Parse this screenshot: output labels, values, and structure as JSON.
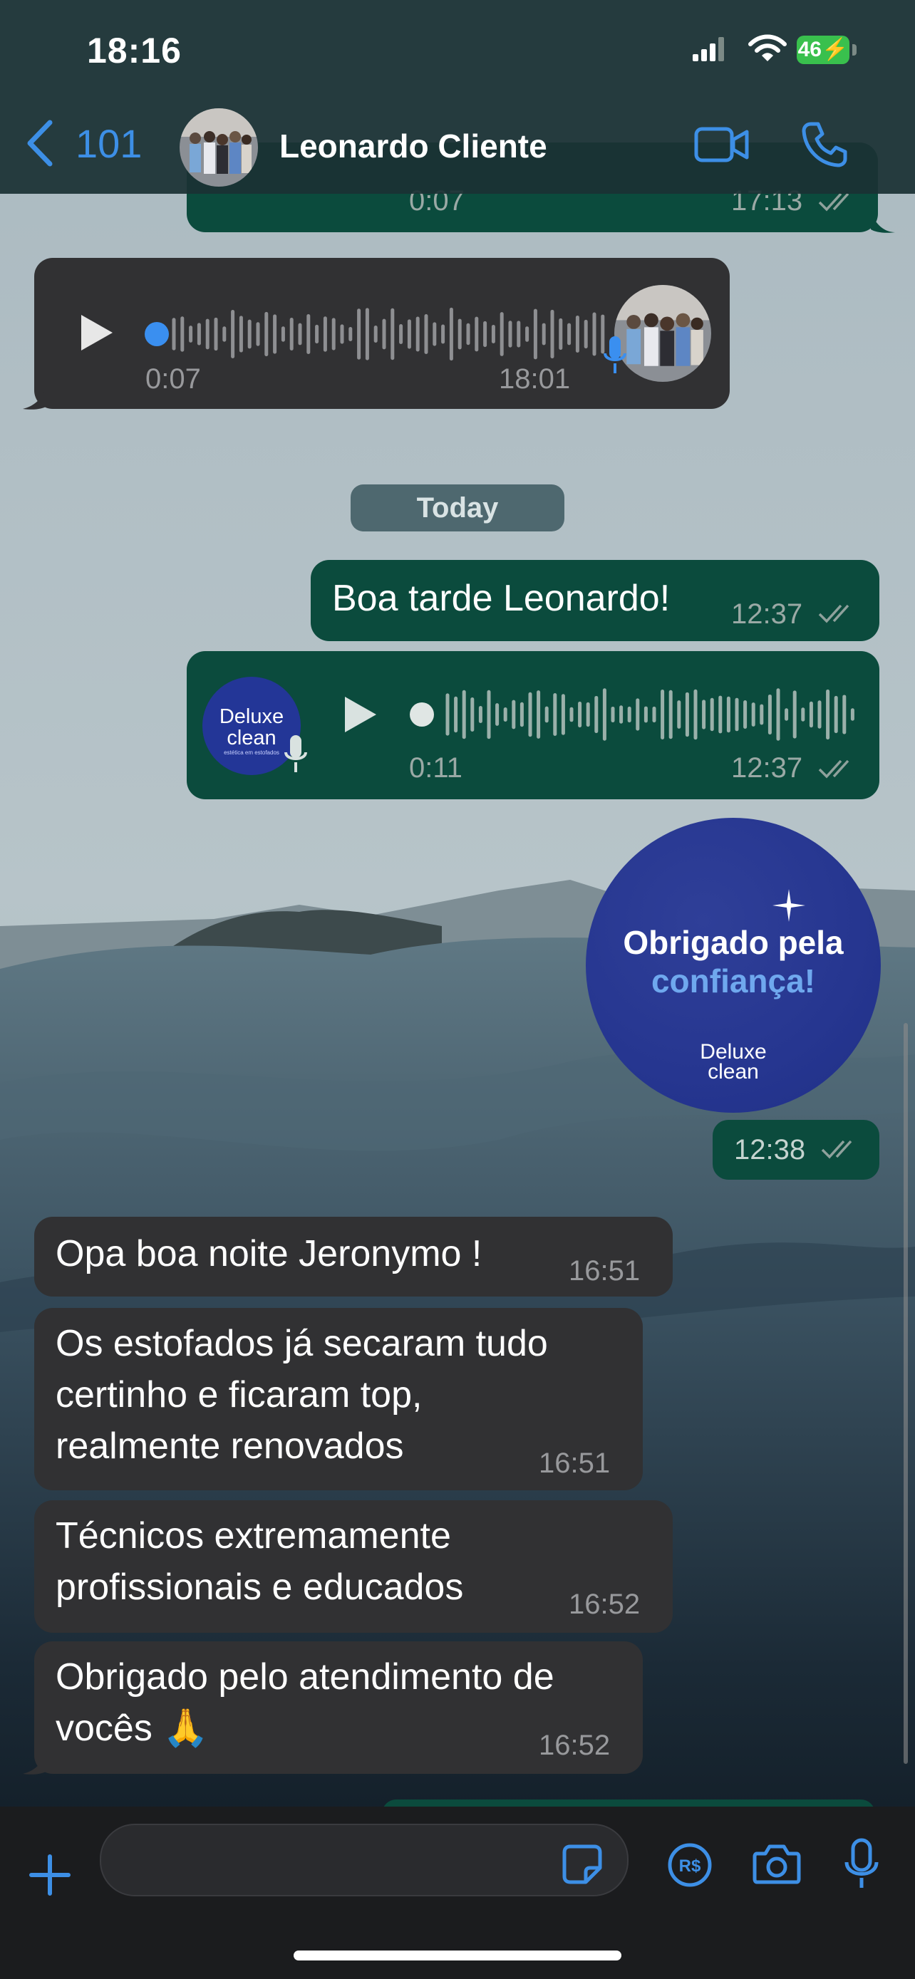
{
  "status_bar": {
    "time": "18:16",
    "battery": "46"
  },
  "header": {
    "back_count": "101",
    "contact_name": "Leonardo Cliente"
  },
  "messages": {
    "top_audio": {
      "duration": "0:07",
      "time": "17:13"
    },
    "in_audio": {
      "duration": "0:07",
      "time": "18:01"
    },
    "date_divider": "Today",
    "greeting": {
      "text": "Boa tarde Leonardo!",
      "time": "12:37"
    },
    "out_audio": {
      "duration": "0:11",
      "time": "12:37",
      "logo_line1": "Deluxe",
      "logo_line2": "clean",
      "logo_tag": "estética em estofados"
    },
    "sticker": {
      "line1": "Obrigado pela",
      "line2": "confiança!",
      "brand1": "Deluxe",
      "brand2": "clean",
      "time": "12:38"
    },
    "in1": {
      "text": "Opa boa noite Jeronymo !",
      "time": "16:51"
    },
    "in2": {
      "line1": "Os estofados já secaram tudo",
      "line2": "certinho e ficaram top,",
      "line3": "realmente renovados",
      "time": "16:51"
    },
    "in3": {
      "line1": "Técnicos extremamente",
      "line2": "profissionais e educados",
      "time": "16:52"
    },
    "in4": {
      "line1": "Obrigado pelo atendimento de",
      "line2": "vocês 🙏",
      "time": "16:52"
    }
  },
  "colors": {
    "accent": "#3d8fe6",
    "outgoing_bubble": "#0b4b3d",
    "incoming_bubble": "#313133",
    "brand_blue": "#263690"
  }
}
